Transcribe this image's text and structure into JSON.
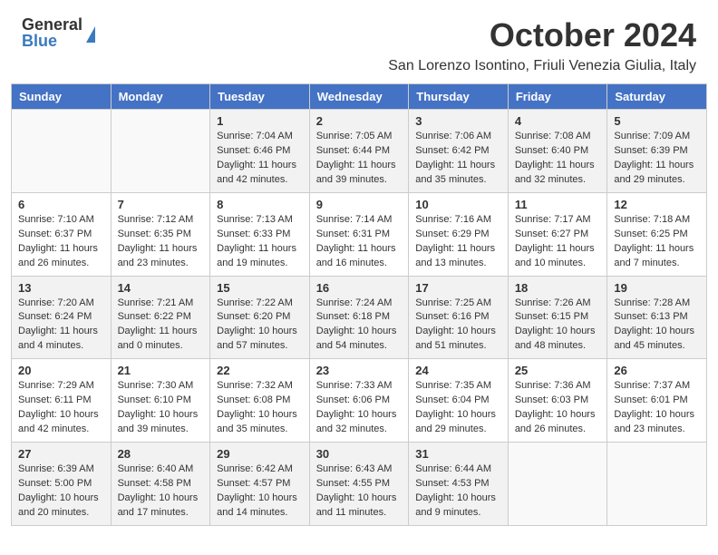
{
  "logo": {
    "general": "General",
    "blue": "Blue"
  },
  "title": "October 2024",
  "subtitle": "San Lorenzo Isontino, Friuli Venezia Giulia, Italy",
  "days": [
    "Sunday",
    "Monday",
    "Tuesday",
    "Wednesday",
    "Thursday",
    "Friday",
    "Saturday"
  ],
  "weeks": [
    [
      {
        "day": "",
        "content": ""
      },
      {
        "day": "",
        "content": ""
      },
      {
        "day": "1",
        "content": "Sunrise: 7:04 AM\nSunset: 6:46 PM\nDaylight: 11 hours and 42 minutes."
      },
      {
        "day": "2",
        "content": "Sunrise: 7:05 AM\nSunset: 6:44 PM\nDaylight: 11 hours and 39 minutes."
      },
      {
        "day": "3",
        "content": "Sunrise: 7:06 AM\nSunset: 6:42 PM\nDaylight: 11 hours and 35 minutes."
      },
      {
        "day": "4",
        "content": "Sunrise: 7:08 AM\nSunset: 6:40 PM\nDaylight: 11 hours and 32 minutes."
      },
      {
        "day": "5",
        "content": "Sunrise: 7:09 AM\nSunset: 6:39 PM\nDaylight: 11 hours and 29 minutes."
      }
    ],
    [
      {
        "day": "6",
        "content": "Sunrise: 7:10 AM\nSunset: 6:37 PM\nDaylight: 11 hours and 26 minutes."
      },
      {
        "day": "7",
        "content": "Sunrise: 7:12 AM\nSunset: 6:35 PM\nDaylight: 11 hours and 23 minutes."
      },
      {
        "day": "8",
        "content": "Sunrise: 7:13 AM\nSunset: 6:33 PM\nDaylight: 11 hours and 19 minutes."
      },
      {
        "day": "9",
        "content": "Sunrise: 7:14 AM\nSunset: 6:31 PM\nDaylight: 11 hours and 16 minutes."
      },
      {
        "day": "10",
        "content": "Sunrise: 7:16 AM\nSunset: 6:29 PM\nDaylight: 11 hours and 13 minutes."
      },
      {
        "day": "11",
        "content": "Sunrise: 7:17 AM\nSunset: 6:27 PM\nDaylight: 11 hours and 10 minutes."
      },
      {
        "day": "12",
        "content": "Sunrise: 7:18 AM\nSunset: 6:25 PM\nDaylight: 11 hours and 7 minutes."
      }
    ],
    [
      {
        "day": "13",
        "content": "Sunrise: 7:20 AM\nSunset: 6:24 PM\nDaylight: 11 hours and 4 minutes."
      },
      {
        "day": "14",
        "content": "Sunrise: 7:21 AM\nSunset: 6:22 PM\nDaylight: 11 hours and 0 minutes."
      },
      {
        "day": "15",
        "content": "Sunrise: 7:22 AM\nSunset: 6:20 PM\nDaylight: 10 hours and 57 minutes."
      },
      {
        "day": "16",
        "content": "Sunrise: 7:24 AM\nSunset: 6:18 PM\nDaylight: 10 hours and 54 minutes."
      },
      {
        "day": "17",
        "content": "Sunrise: 7:25 AM\nSunset: 6:16 PM\nDaylight: 10 hours and 51 minutes."
      },
      {
        "day": "18",
        "content": "Sunrise: 7:26 AM\nSunset: 6:15 PM\nDaylight: 10 hours and 48 minutes."
      },
      {
        "day": "19",
        "content": "Sunrise: 7:28 AM\nSunset: 6:13 PM\nDaylight: 10 hours and 45 minutes."
      }
    ],
    [
      {
        "day": "20",
        "content": "Sunrise: 7:29 AM\nSunset: 6:11 PM\nDaylight: 10 hours and 42 minutes."
      },
      {
        "day": "21",
        "content": "Sunrise: 7:30 AM\nSunset: 6:10 PM\nDaylight: 10 hours and 39 minutes."
      },
      {
        "day": "22",
        "content": "Sunrise: 7:32 AM\nSunset: 6:08 PM\nDaylight: 10 hours and 35 minutes."
      },
      {
        "day": "23",
        "content": "Sunrise: 7:33 AM\nSunset: 6:06 PM\nDaylight: 10 hours and 32 minutes."
      },
      {
        "day": "24",
        "content": "Sunrise: 7:35 AM\nSunset: 6:04 PM\nDaylight: 10 hours and 29 minutes."
      },
      {
        "day": "25",
        "content": "Sunrise: 7:36 AM\nSunset: 6:03 PM\nDaylight: 10 hours and 26 minutes."
      },
      {
        "day": "26",
        "content": "Sunrise: 7:37 AM\nSunset: 6:01 PM\nDaylight: 10 hours and 23 minutes."
      }
    ],
    [
      {
        "day": "27",
        "content": "Sunrise: 6:39 AM\nSunset: 5:00 PM\nDaylight: 10 hours and 20 minutes."
      },
      {
        "day": "28",
        "content": "Sunrise: 6:40 AM\nSunset: 4:58 PM\nDaylight: 10 hours and 17 minutes."
      },
      {
        "day": "29",
        "content": "Sunrise: 6:42 AM\nSunset: 4:57 PM\nDaylight: 10 hours and 14 minutes."
      },
      {
        "day": "30",
        "content": "Sunrise: 6:43 AM\nSunset: 4:55 PM\nDaylight: 10 hours and 11 minutes."
      },
      {
        "day": "31",
        "content": "Sunrise: 6:44 AM\nSunset: 4:53 PM\nDaylight: 10 hours and 9 minutes."
      },
      {
        "day": "",
        "content": ""
      },
      {
        "day": "",
        "content": ""
      }
    ]
  ]
}
